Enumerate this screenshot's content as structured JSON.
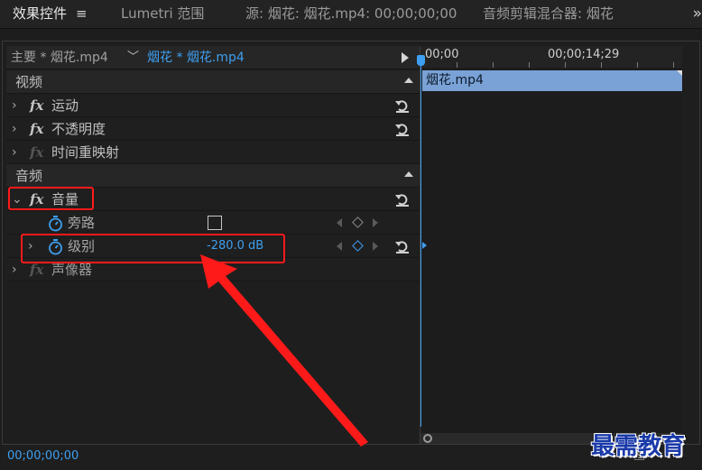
{
  "tabs": [
    {
      "label": "效果控件",
      "menu_icon": "≡",
      "active": true
    },
    {
      "label": "Lumetri 范围"
    },
    {
      "label": "源: 烟花: 烟花.mp4: 00;00;00;00"
    },
    {
      "label": "音频剪辑混合器: 烟花"
    }
  ],
  "overflow_icon": "»",
  "clip_bar": {
    "master": "主要 * 烟花.mp4",
    "sequence": "烟花 * 烟花.mp4"
  },
  "sections": {
    "video": "视频",
    "audio": "音频"
  },
  "effects": {
    "fx_glyph": "fx",
    "motion": "运动",
    "opacity": "不透明度",
    "time_remap": "时间重映射",
    "volume": "音量",
    "panner": "声像器"
  },
  "params": {
    "bypass": "旁路",
    "level": "级别",
    "level_value": "-280.0 dB"
  },
  "timeline": {
    "start_time": "00;00",
    "end_time": "00;00;14;29",
    "clip_name": "烟花.mp4"
  },
  "footer": {
    "timecode": "00;00;00;00"
  },
  "colors": {
    "accent": "#3e9ff0",
    "clip": "#7aa2d6",
    "annotation": "#ff1a1a"
  },
  "watermark": "最需教育"
}
